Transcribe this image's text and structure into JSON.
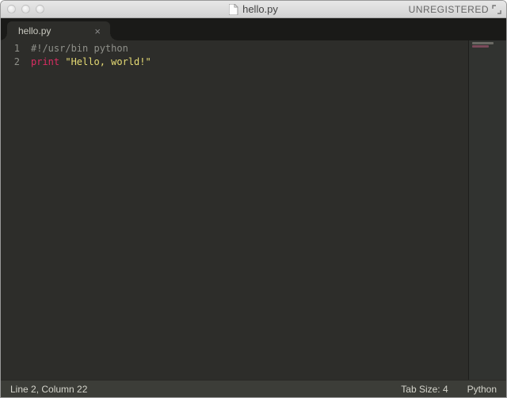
{
  "titlebar": {
    "filename": "hello.py",
    "registration": "UNREGISTERED"
  },
  "tab": {
    "label": "hello.py",
    "close_glyph": "×"
  },
  "editor": {
    "lines": [
      {
        "number": "1",
        "tokens": [
          {
            "cls": "tok-comment",
            "text": "#!/usr/bin python"
          }
        ]
      },
      {
        "number": "2",
        "tokens": [
          {
            "cls": "tok-keyword",
            "text": "print"
          },
          {
            "cls": "",
            "text": " "
          },
          {
            "cls": "tok-string",
            "text": "\"Hello, world!\""
          }
        ]
      }
    ]
  },
  "statusbar": {
    "position": "Line 2, Column 22",
    "tabsize": "Tab Size: 4",
    "language": "Python"
  }
}
